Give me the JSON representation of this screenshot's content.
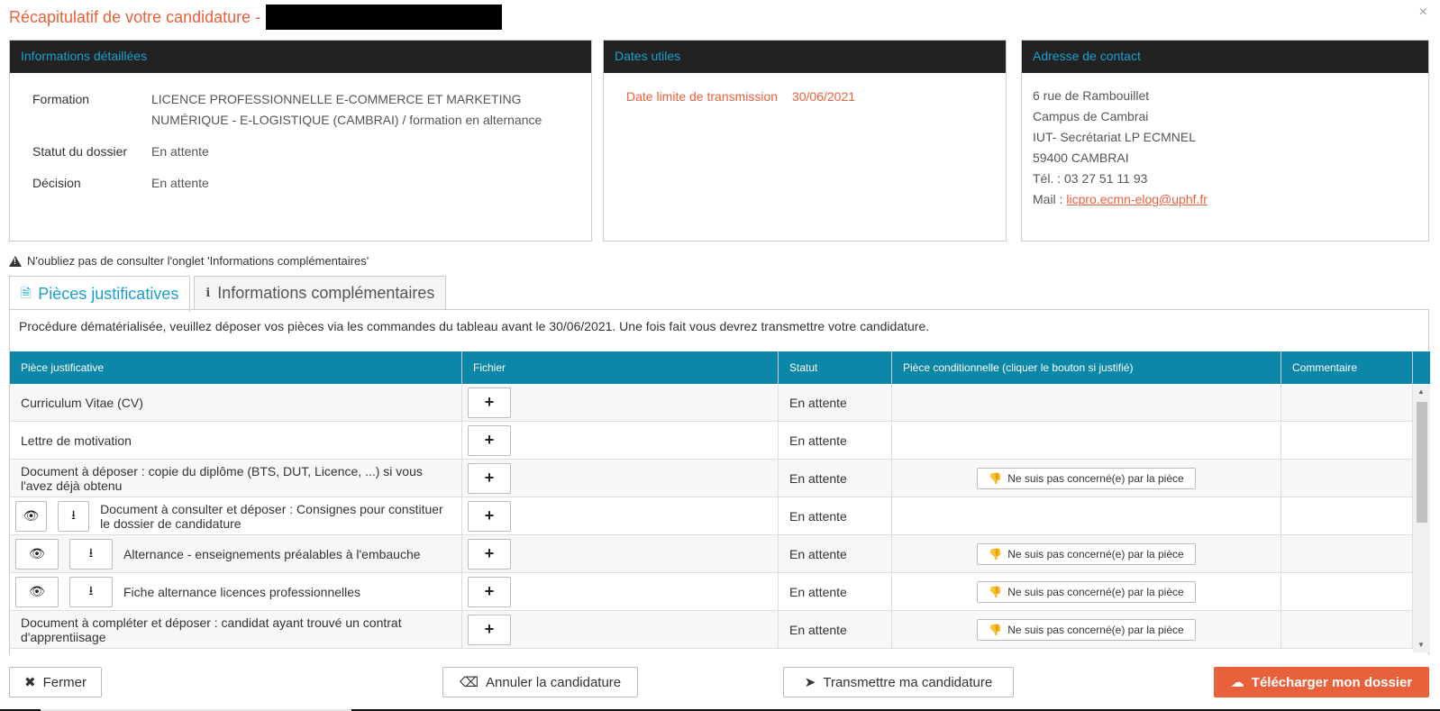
{
  "header": {
    "title": "Récapitulatif de votre candidature -",
    "close": "×"
  },
  "panels": {
    "details": {
      "heading": "Informations détaillées",
      "rows": [
        {
          "label": "Formation",
          "value": "LICENCE PROFESSIONNELLE E-COMMERCE ET MARKETING NUMÉRIQUE - E-LOGISTIQUE (CAMBRAI) / formation en alternance"
        },
        {
          "label": "Statut du dossier",
          "value": "En attente"
        },
        {
          "label": "Décision",
          "value": "En attente"
        }
      ]
    },
    "dates": {
      "heading": "Dates utiles",
      "label": "Date limite de transmission",
      "value": "30/06/2021"
    },
    "contact": {
      "heading": "Adresse de contact",
      "lines": [
        "6 rue de Rambouillet",
        "Campus de Cambrai",
        "IUT- Secrétariat LP ECMNEL",
        "59400 CAMBRAI",
        "Tél. : 03 27 51 11 93"
      ],
      "mail_label": "Mail :",
      "mail": "licpro.ecmn-elog@uphf.fr"
    }
  },
  "notice": "N'oubliez pas de consulter l'onglet 'Informations complémentaires'",
  "tabs": [
    {
      "label": "Pièces justificatives",
      "icon": "document-icon"
    },
    {
      "label": "Informations complémentaires",
      "icon": "info-icon"
    }
  ],
  "procedure_text": "Procédure dématérialisée, veuillez déposer vos pièces via les commandes du tableau avant le 30/06/2021. Une fois fait vous devrez transmettre votre candidature.",
  "table": {
    "headers": [
      "Pièce justificative",
      "Fichier",
      "Statut",
      "Pièce conditionnelle (cliquer le bouton si justifié)",
      "Commentaire"
    ],
    "rows": [
      {
        "label": "Curriculum Vitae (CV)",
        "status": "En attente",
        "view": false,
        "conditional": ""
      },
      {
        "label": "Lettre de motivation",
        "status": "En attente",
        "view": false,
        "conditional": ""
      },
      {
        "label": "Document à déposer : copie du diplôme (BTS, DUT, Licence, ...) si vous l'avez déjà obtenu",
        "status": "En attente",
        "view": false,
        "conditional": "Ne suis pas concerné(e) par la pièce"
      },
      {
        "label": "Document à consulter et déposer : Consignes pour constituer le dossier de candidature",
        "status": "En attente",
        "view": true,
        "conditional": ""
      },
      {
        "label": "Alternance - enseignements préalables à l'embauche",
        "status": "En attente",
        "view": true,
        "conditional": "Ne suis pas concerné(e) par la pièce"
      },
      {
        "label": "Fiche alternance licences professionnelles",
        "status": "En attente",
        "view": true,
        "conditional": "Ne suis pas concerné(e) par la pièce"
      },
      {
        "label": "Document à compléter et déposer : candidat ayant trouvé un contrat d'apprentiisage",
        "status": "En attente",
        "view": false,
        "conditional": "Ne suis pas concerné(e) par la pièce"
      }
    ]
  },
  "footer": {
    "close": "Fermer",
    "cancel": "Annuler la candidature",
    "submit": "Transmettre ma candidature",
    "download": "Télécharger mon dossier"
  },
  "colors": {
    "accent": "#e8613a",
    "header_blue": "#0c87a8",
    "panel_head": "#222222",
    "panel_title": "#1aa0d0"
  }
}
